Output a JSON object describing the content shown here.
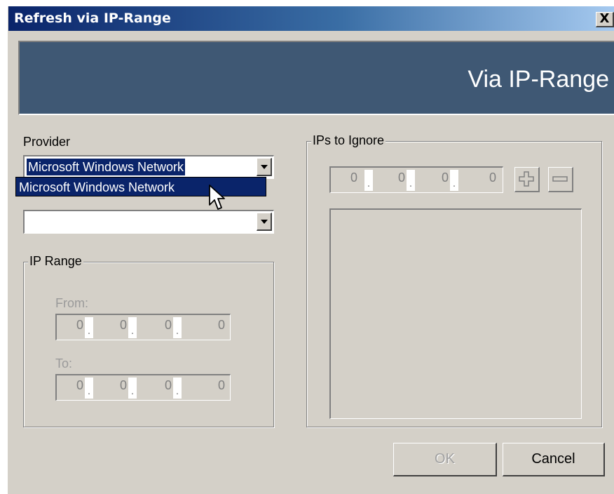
{
  "window": {
    "title": "Refresh via IP-Range",
    "close_label": "X"
  },
  "banner": {
    "heading": "Via IP-Range"
  },
  "provider": {
    "label": "Provider",
    "selected": "Microsoft Windows Network",
    "dropdown_items": [
      "Microsoft Windows Network"
    ],
    "second_combo_value": ""
  },
  "ip_range": {
    "group_title": "IP Range",
    "from_label": "From:",
    "to_label": "To:",
    "from_octets": [
      "0",
      "0",
      "0",
      "0"
    ],
    "to_octets": [
      "0",
      "0",
      "0",
      "0"
    ]
  },
  "ips_to_ignore": {
    "group_title": "IPs to Ignore",
    "octets": [
      "0",
      "0",
      "0",
      "0"
    ],
    "add_icon": "plus-icon",
    "remove_icon": "minus-icon",
    "items": []
  },
  "buttons": {
    "ok": "OK",
    "cancel": "Cancel"
  },
  "colors": {
    "title_gradient_start": "#0a246a",
    "title_gradient_end": "#a6caf0",
    "banner_bg": "#3f5874",
    "selection": "#0a246a",
    "dialog_bg": "#d4d0c8"
  }
}
